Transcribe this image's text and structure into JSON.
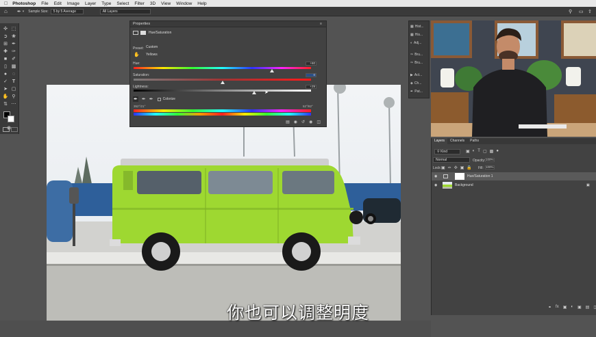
{
  "menubar": {
    "items": [
      "Photoshop",
      "File",
      "Edit",
      "Image",
      "Layer",
      "Type",
      "Select",
      "Filter",
      "3D",
      "View",
      "Window",
      "Help"
    ]
  },
  "options": {
    "sample_size_label": "Sample Size:",
    "sample_size_value": "5 by 5 Average",
    "sample_value": "All Layers"
  },
  "properties": {
    "tab_title": "Properties",
    "adjustment_name": "Hue/Saturation",
    "preset_label": "Preset:",
    "preset_value": "Custom",
    "channel_value": "Yellows",
    "hue_label": "Hue:",
    "hue_value": "+60",
    "hue_level": 0.78,
    "saturation_label": "Saturation:",
    "saturation_value": "0",
    "saturation_level": 0.5,
    "lightness_label": "Lightness:",
    "lightness_value": "+29",
    "lightness_level": 0.68,
    "colorize_label": "Colorize",
    "range_left": "352°/21°",
    "range_right": "52°/82°"
  },
  "minipanel": {
    "items": [
      "Hist...",
      "His...",
      "Adj...",
      "Bru...",
      "Bru...",
      "Act...",
      "Ch...",
      "Pat..."
    ]
  },
  "layers": {
    "tabs": [
      "Layers",
      "Channels",
      "Paths"
    ],
    "filter_kind": "Kind",
    "blend_mode": "Normal",
    "opacity_label": "Opacity:",
    "opacity_value": "100%",
    "lock_label": "Lock:",
    "fill_label": "Fill:",
    "fill_value": "100%",
    "rows": [
      {
        "name": "Hue/Saturation 1"
      },
      {
        "name": "Background"
      }
    ]
  },
  "subtitle": "你也可以调整明度",
  "colors": {
    "bus_green": "#9ed831",
    "panel_bg": "#424242",
    "menubar_bg": "#e8e8e8"
  }
}
